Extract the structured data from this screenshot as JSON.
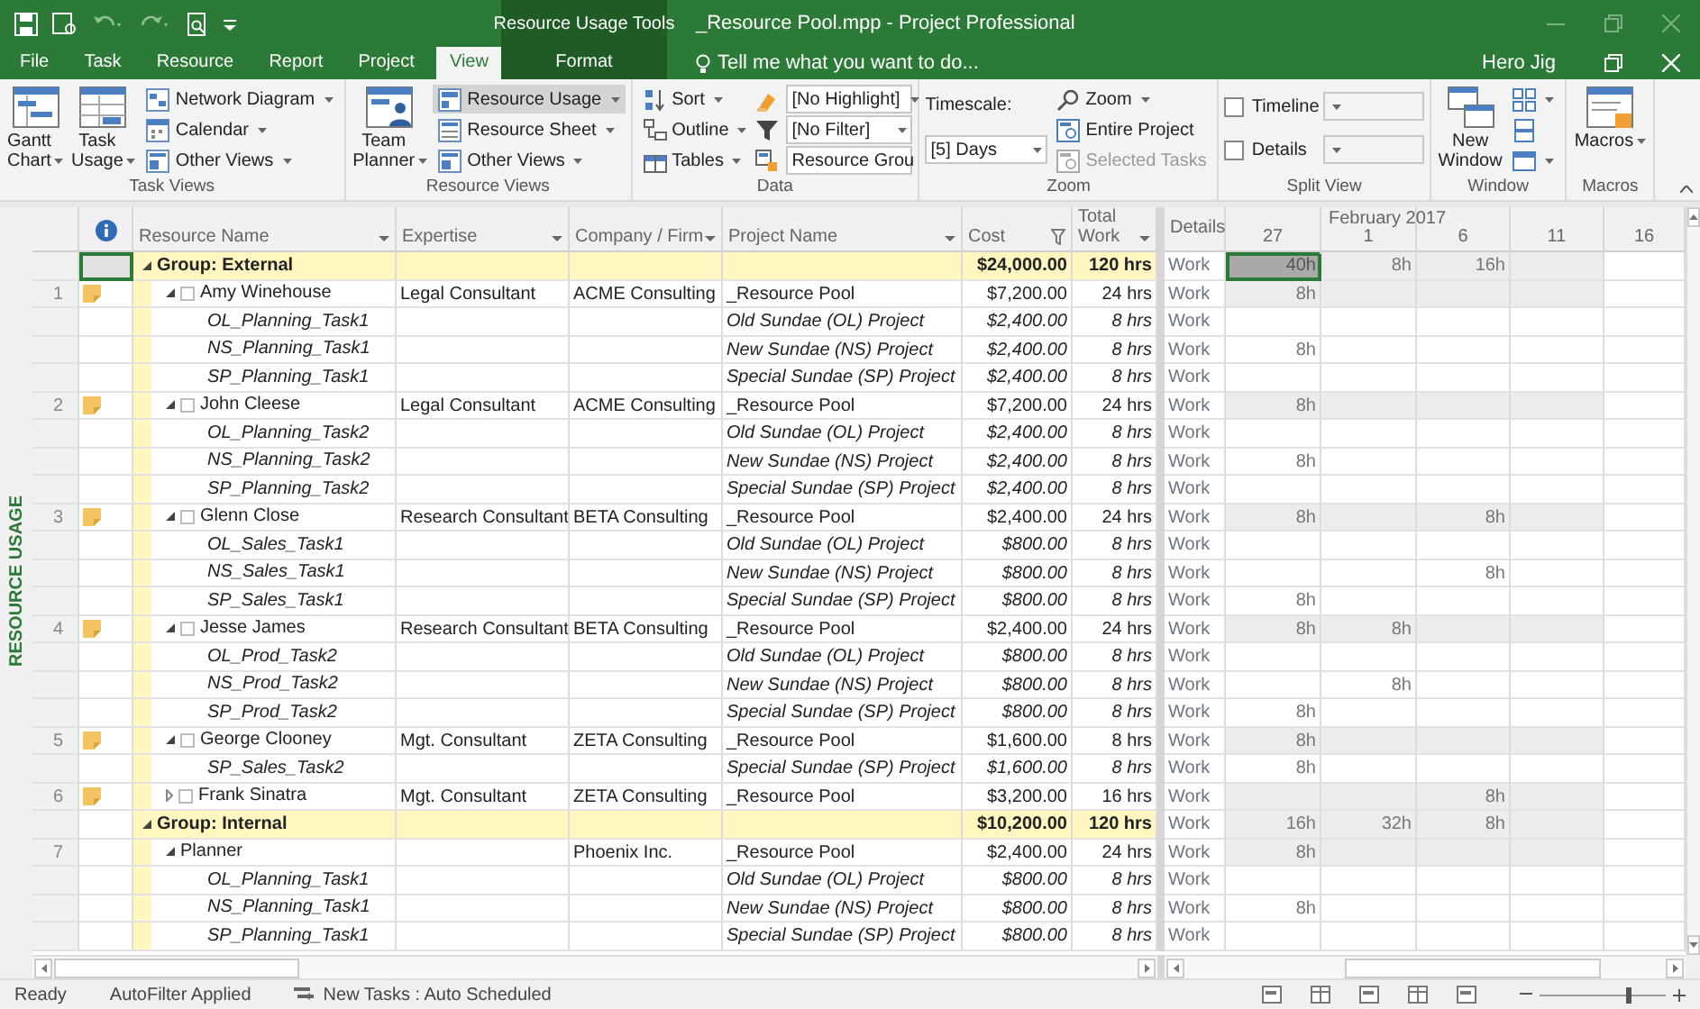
{
  "title_bar": {
    "context_label": "Resource Usage Tools",
    "title": "_Resource Pool.mpp - Project Professional"
  },
  "ribbon_tabs": [
    {
      "label": "File",
      "selected": false,
      "kind": "normal"
    },
    {
      "label": "Task",
      "selected": false,
      "kind": "normal"
    },
    {
      "label": "Resource",
      "selected": false,
      "kind": "normal"
    },
    {
      "label": "Report",
      "selected": false,
      "kind": "normal"
    },
    {
      "label": "Project",
      "selected": false,
      "kind": "normal"
    },
    {
      "label": "View",
      "selected": true,
      "kind": "normal"
    },
    {
      "label": "Format",
      "selected": false,
      "kind": "contextual"
    }
  ],
  "tell_me": {
    "placeholder": "Tell me what you want to do..."
  },
  "user": "Hero Jig",
  "ribbon_groups": [
    {
      "label": "Task Views",
      "columns": [
        [
          {
            "kind": "large",
            "label": "Gantt Chart",
            "dropdown": true
          }
        ],
        [
          {
            "kind": "large",
            "label": "Task Usage",
            "dropdown": true
          }
        ],
        [
          {
            "kind": "small",
            "label": "Network Diagram",
            "dropdown": true
          },
          {
            "kind": "small",
            "label": "Calendar",
            "dropdown": true
          },
          {
            "kind": "small",
            "label": "Other Views",
            "dropdown": true
          }
        ]
      ]
    },
    {
      "label": "Resource Views",
      "columns": [
        [
          {
            "kind": "large",
            "label": "Team Planner",
            "dropdown": true
          }
        ],
        [
          {
            "kind": "small",
            "label": "Resource Usage",
            "dropdown": true,
            "selected": true
          },
          {
            "kind": "small",
            "label": "Resource Sheet",
            "dropdown": true,
            "selected": false
          },
          {
            "kind": "small",
            "label": "Other Views",
            "dropdown": true,
            "selected": false
          }
        ]
      ]
    },
    {
      "label": "Data",
      "columns": [
        [
          {
            "kind": "small",
            "label": "Sort",
            "dropdown": true
          },
          {
            "kind": "small",
            "label": "Outline",
            "dropdown": true
          },
          {
            "kind": "small",
            "label": "Tables",
            "dropdown": true
          }
        ],
        [
          {
            "kind": "iconselect",
            "value": "[No Highlight]"
          },
          {
            "kind": "iconselect",
            "value": "[No Filter]"
          },
          {
            "kind": "iconselect",
            "value": "Resource Grou"
          }
        ]
      ]
    },
    {
      "label": "Zoom",
      "columns": [
        [
          {
            "kind": "label",
            "label": "Timescale:"
          },
          {
            "kind": "select",
            "value": "[5] Days"
          }
        ],
        [
          {
            "kind": "small",
            "label": "Zoom",
            "dropdown": true,
            "disabled": false
          },
          {
            "kind": "small",
            "label": "Entire Project",
            "dropdown": false,
            "disabled": false
          },
          {
            "kind": "small",
            "label": "Selected Tasks",
            "dropdown": false,
            "disabled": true
          }
        ]
      ]
    },
    {
      "label": "Split View",
      "columns": [
        [
          {
            "kind": "check",
            "label": "Timeline",
            "checked": false
          },
          {
            "kind": "check",
            "label": "Details",
            "checked": false
          }
        ],
        [
          {
            "kind": "select",
            "disabled": true
          },
          {
            "kind": "select",
            "disabled": true
          }
        ]
      ]
    },
    {
      "label": "Window",
      "columns": [
        [
          {
            "kind": "large",
            "label": "New Window",
            "dropdown": false
          }
        ],
        [
          {
            "kind": "iconbutton",
            "dropdown": true
          },
          {
            "kind": "iconbutton",
            "dropdown": false
          },
          {
            "kind": "iconbutton",
            "dropdown": true
          }
        ]
      ]
    },
    {
      "label": "Macros",
      "columns": [
        [
          {
            "kind": "large",
            "label": "Macros",
            "dropdown": true
          }
        ]
      ]
    }
  ],
  "view_label": "RESOURCE USAGE",
  "table": {
    "columns": [
      {
        "label": "Resource Name",
        "filtered": false
      },
      {
        "label": "Expertise",
        "filtered": false
      },
      {
        "label": "Company / Firm",
        "filtered": false
      },
      {
        "label": "Project Name",
        "filtered": false
      },
      {
        "label": "Cost",
        "filtered": true
      },
      {
        "label": "Total Work",
        "filtered": false
      }
    ],
    "timescale": {
      "details_label": "Details",
      "month": "February 2017",
      "periods": [
        "27",
        "1",
        "6",
        "11",
        "16"
      ]
    },
    "rows": [
      {
        "kind": "group",
        "name": "Group: External",
        "expanded": true,
        "selected": true,
        "cost": "$24,000.00",
        "work": "120 hrs",
        "details": "Work",
        "values": [
          {
            "kind": "work",
            "text": "40h"
          },
          {
            "kind": "work",
            "text": "8h"
          },
          {
            "kind": "work",
            "text": "16h"
          },
          {
            "kind": "blank"
          },
          {
            "kind": "blank"
          }
        ]
      },
      {
        "kind": "resource",
        "id": "1",
        "note": true,
        "expanded": true,
        "checked": false,
        "selected": false,
        "name": "Amy Winehouse",
        "expertise": "Legal Consultant",
        "company": "ACME Consulting",
        "project": "_Resource Pool",
        "cost": "$7,200.00",
        "work": "24 hrs",
        "details": "Work",
        "values": [
          {
            "kind": "work",
            "text": "8h"
          },
          {
            "kind": "blank"
          },
          {
            "kind": "blank"
          },
          {
            "kind": "blank"
          },
          {
            "kind": "blank"
          }
        ]
      },
      {
        "kind": "assignment",
        "selected": false,
        "name": "OL_Planning_Task1",
        "project": "Old Sundae (OL) Project",
        "cost": "$2,400.00",
        "work": "8 hrs",
        "details": "Work",
        "values": [
          {
            "kind": "blank"
          },
          {
            "kind": "blank"
          },
          {
            "kind": "blank"
          },
          {
            "kind": "blank"
          },
          {
            "kind": "blank"
          }
        ]
      },
      {
        "kind": "assignment",
        "selected": false,
        "name": "NS_Planning_Task1",
        "project": "New Sundae (NS) Project",
        "cost": "$2,400.00",
        "work": "8 hrs",
        "details": "Work",
        "values": [
          {
            "kind": "work",
            "text": "8h"
          },
          {
            "kind": "blank"
          },
          {
            "kind": "blank"
          },
          {
            "kind": "blank"
          },
          {
            "kind": "blank"
          }
        ]
      },
      {
        "kind": "assignment",
        "selected": false,
        "name": "SP_Planning_Task1",
        "project": "Special Sundae (SP) Project",
        "cost": "$2,400.00",
        "work": "8 hrs",
        "details": "Work",
        "values": [
          {
            "kind": "blank"
          },
          {
            "kind": "blank"
          },
          {
            "kind": "blank"
          },
          {
            "kind": "blank"
          },
          {
            "kind": "blank"
          }
        ]
      },
      {
        "kind": "resource",
        "id": "2",
        "note": true,
        "expanded": true,
        "checked": false,
        "selected": false,
        "name": "John Cleese",
        "expertise": "Legal Consultant",
        "company": "ACME Consulting",
        "project": "_Resource Pool",
        "cost": "$7,200.00",
        "work": "24 hrs",
        "details": "Work",
        "values": [
          {
            "kind": "work",
            "text": "8h"
          },
          {
            "kind": "blank"
          },
          {
            "kind": "blank"
          },
          {
            "kind": "blank"
          },
          {
            "kind": "blank"
          }
        ]
      },
      {
        "kind": "assignment",
        "selected": false,
        "name": "OL_Planning_Task2",
        "project": "Old Sundae (OL) Project",
        "cost": "$2,400.00",
        "work": "8 hrs",
        "details": "Work",
        "values": [
          {
            "kind": "blank"
          },
          {
            "kind": "blank"
          },
          {
            "kind": "blank"
          },
          {
            "kind": "blank"
          },
          {
            "kind": "blank"
          }
        ]
      },
      {
        "kind": "assignment",
        "selected": false,
        "name": "NS_Planning_Task2",
        "project": "New Sundae (NS) Project",
        "cost": "$2,400.00",
        "work": "8 hrs",
        "details": "Work",
        "values": [
          {
            "kind": "work",
            "text": "8h"
          },
          {
            "kind": "blank"
          },
          {
            "kind": "blank"
          },
          {
            "kind": "blank"
          },
          {
            "kind": "blank"
          }
        ]
      },
      {
        "kind": "assignment",
        "selected": false,
        "name": "SP_Planning_Task2",
        "project": "Special Sundae (SP) Project",
        "cost": "$2,400.00",
        "work": "8 hrs",
        "details": "Work",
        "values": [
          {
            "kind": "blank"
          },
          {
            "kind": "blank"
          },
          {
            "kind": "blank"
          },
          {
            "kind": "blank"
          },
          {
            "kind": "blank"
          }
        ]
      },
      {
        "kind": "resource",
        "id": "3",
        "note": true,
        "expanded": true,
        "checked": false,
        "selected": false,
        "name": "Glenn Close",
        "expertise": "Research Consultant",
        "company": "BETA Consulting",
        "project": "_Resource Pool",
        "cost": "$2,400.00",
        "work": "24 hrs",
        "details": "Work",
        "values": [
          {
            "kind": "work",
            "text": "8h"
          },
          {
            "kind": "blank"
          },
          {
            "kind": "work",
            "text": "8h"
          },
          {
            "kind": "blank"
          },
          {
            "kind": "blank"
          }
        ]
      },
      {
        "kind": "assignment",
        "selected": false,
        "name": "OL_Sales_Task1",
        "project": "Old Sundae (OL) Project",
        "cost": "$800.00",
        "work": "8 hrs",
        "details": "Work",
        "values": [
          {
            "kind": "blank"
          },
          {
            "kind": "blank"
          },
          {
            "kind": "blank"
          },
          {
            "kind": "blank"
          },
          {
            "kind": "blank"
          }
        ]
      },
      {
        "kind": "assignment",
        "selected": false,
        "name": "NS_Sales_Task1",
        "project": "New Sundae (NS) Project",
        "cost": "$800.00",
        "work": "8 hrs",
        "details": "Work",
        "values": [
          {
            "kind": "blank"
          },
          {
            "kind": "blank"
          },
          {
            "kind": "work",
            "text": "8h"
          },
          {
            "kind": "blank"
          },
          {
            "kind": "blank"
          }
        ]
      },
      {
        "kind": "assignment",
        "selected": false,
        "name": "SP_Sales_Task1",
        "project": "Special Sundae (SP) Project",
        "cost": "$800.00",
        "work": "8 hrs",
        "details": "Work",
        "values": [
          {
            "kind": "work",
            "text": "8h"
          },
          {
            "kind": "blank"
          },
          {
            "kind": "blank"
          },
          {
            "kind": "blank"
          },
          {
            "kind": "blank"
          }
        ]
      },
      {
        "kind": "resource",
        "id": "4",
        "note": true,
        "expanded": true,
        "checked": false,
        "selected": false,
        "name": "Jesse James",
        "expertise": "Research Consultant",
        "company": "BETA Consulting",
        "project": "_Resource Pool",
        "cost": "$2,400.00",
        "work": "24 hrs",
        "details": "Work",
        "values": [
          {
            "kind": "work",
            "text": "8h"
          },
          {
            "kind": "work",
            "text": "8h"
          },
          {
            "kind": "blank"
          },
          {
            "kind": "blank"
          },
          {
            "kind": "blank"
          }
        ]
      },
      {
        "kind": "assignment",
        "selected": false,
        "name": "OL_Prod_Task2",
        "project": "Old Sundae (OL) Project",
        "cost": "$800.00",
        "work": "8 hrs",
        "details": "Work",
        "values": [
          {
            "kind": "blank"
          },
          {
            "kind": "blank"
          },
          {
            "kind": "blank"
          },
          {
            "kind": "blank"
          },
          {
            "kind": "blank"
          }
        ]
      },
      {
        "kind": "assignment",
        "selected": false,
        "name": "NS_Prod_Task2",
        "project": "New Sundae (NS) Project",
        "cost": "$800.00",
        "work": "8 hrs",
        "details": "Work",
        "values": [
          {
            "kind": "blank"
          },
          {
            "kind": "work",
            "text": "8h"
          },
          {
            "kind": "blank"
          },
          {
            "kind": "blank"
          },
          {
            "kind": "blank"
          }
        ]
      },
      {
        "kind": "assignment",
        "selected": false,
        "name": "SP_Prod_Task2",
        "project": "Special Sundae (SP) Project",
        "cost": "$800.00",
        "work": "8 hrs",
        "details": "Work",
        "values": [
          {
            "kind": "work",
            "text": "8h"
          },
          {
            "kind": "blank"
          },
          {
            "kind": "blank"
          },
          {
            "kind": "blank"
          },
          {
            "kind": "blank"
          }
        ]
      },
      {
        "kind": "resource",
        "id": "5",
        "note": true,
        "expanded": true,
        "checked": false,
        "selected": false,
        "name": "George Clooney",
        "expertise": "Mgt. Consultant",
        "company": "ZETA Consulting",
        "project": "_Resource Pool",
        "cost": "$1,600.00",
        "work": "8 hrs",
        "details": "Work",
        "values": [
          {
            "kind": "work",
            "text": "8h"
          },
          {
            "kind": "blank"
          },
          {
            "kind": "blank"
          },
          {
            "kind": "blank"
          },
          {
            "kind": "blank"
          }
        ]
      },
      {
        "kind": "assignment",
        "selected": false,
        "name": "SP_Sales_Task2",
        "project": "Special Sundae (SP) Project",
        "cost": "$1,600.00",
        "work": "8 hrs",
        "details": "Work",
        "values": [
          {
            "kind": "work",
            "text": "8h"
          },
          {
            "kind": "blank"
          },
          {
            "kind": "blank"
          },
          {
            "kind": "blank"
          },
          {
            "kind": "blank"
          }
        ]
      },
      {
        "kind": "resource",
        "id": "6",
        "note": true,
        "expanded": false,
        "checked": false,
        "selected": false,
        "name": "Frank Sinatra",
        "expertise": "Mgt. Consultant",
        "company": "ZETA Consulting",
        "project": "_Resource Pool",
        "cost": "$3,200.00",
        "work": "16 hrs",
        "details": "Work",
        "values": [
          {
            "kind": "blank"
          },
          {
            "kind": "blank"
          },
          {
            "kind": "work",
            "text": "8h"
          },
          {
            "kind": "blank"
          },
          {
            "kind": "blank"
          }
        ]
      },
      {
        "kind": "group",
        "name": "Group: Internal",
        "expanded": true,
        "selected": false,
        "cost": "$10,200.00",
        "work": "120 hrs",
        "details": "Work",
        "values": [
          {
            "kind": "work",
            "text": "16h"
          },
          {
            "kind": "work",
            "text": "32h"
          },
          {
            "kind": "work",
            "text": "8h"
          },
          {
            "kind": "blank"
          },
          {
            "kind": "blank"
          }
        ]
      },
      {
        "kind": "resource",
        "id": "7",
        "note": false,
        "expanded": true,
        "selected": false,
        "name": "Planner",
        "company": "Phoenix Inc.",
        "project": "_Resource Pool",
        "cost": "$2,400.00",
        "work": "24 hrs",
        "details": "Work",
        "values": [
          {
            "kind": "work",
            "text": "8h"
          },
          {
            "kind": "blank"
          },
          {
            "kind": "blank"
          },
          {
            "kind": "blank"
          },
          {
            "kind": "blank"
          }
        ]
      },
      {
        "kind": "assignment",
        "selected": false,
        "name": "OL_Planning_Task1",
        "project": "Old Sundae (OL) Project",
        "cost": "$800.00",
        "work": "8 hrs",
        "details": "Work",
        "values": [
          {
            "kind": "blank"
          },
          {
            "kind": "blank"
          },
          {
            "kind": "blank"
          },
          {
            "kind": "blank"
          },
          {
            "kind": "blank"
          }
        ]
      },
      {
        "kind": "assignment",
        "selected": false,
        "name": "NS_Planning_Task1",
        "project": "New Sundae (NS) Project",
        "cost": "$800.00",
        "work": "8 hrs",
        "details": "Work",
        "values": [
          {
            "kind": "work",
            "text": "8h"
          },
          {
            "kind": "blank"
          },
          {
            "kind": "blank"
          },
          {
            "kind": "blank"
          },
          {
            "kind": "blank"
          }
        ]
      },
      {
        "kind": "assignment",
        "selected": false,
        "name": "SP_Planning_Task1",
        "project": "Special Sundae (SP) Project",
        "cost": "$800.00",
        "work": "8 hrs",
        "details": "Work",
        "values": [
          {
            "kind": "blank"
          },
          {
            "kind": "blank"
          },
          {
            "kind": "blank"
          },
          {
            "kind": "blank"
          },
          {
            "kind": "blank"
          }
        ]
      }
    ]
  },
  "status_bar": {
    "items": [
      "Ready",
      "AutoFilter Applied"
    ],
    "new_tasks": "New Tasks : Auto Scheduled",
    "zoom": {
      "level": 0.7
    }
  }
}
